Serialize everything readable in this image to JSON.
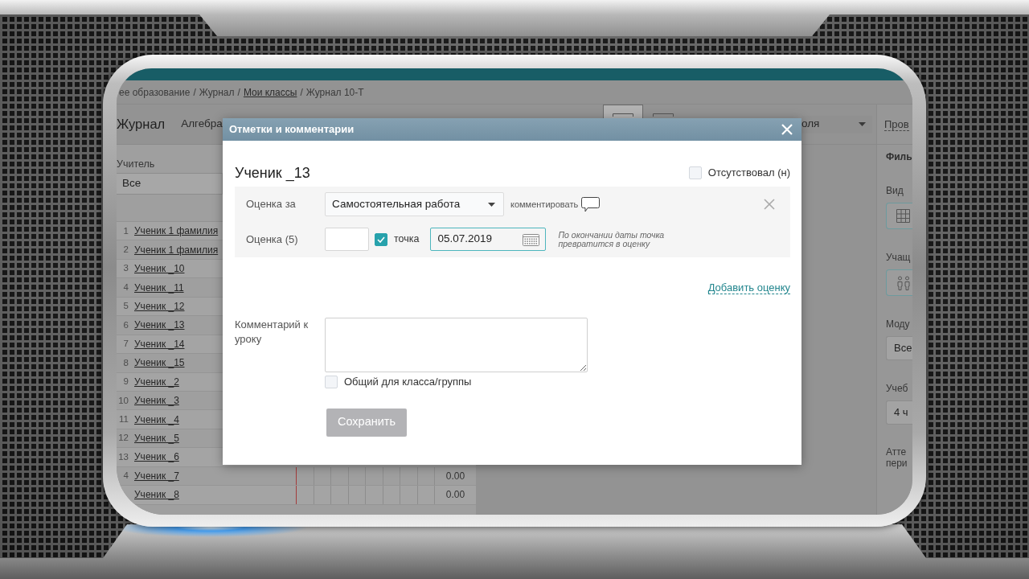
{
  "breadcrumb": [
    {
      "kind": "text",
      "text": "ее образование"
    },
    {
      "kind": "separator",
      "text": "/"
    },
    {
      "kind": "text",
      "text": "Журнал"
    },
    {
      "kind": "separator",
      "text": "/"
    },
    {
      "kind": "link",
      "text": "Мои классы"
    },
    {
      "kind": "separator",
      "text": "/"
    },
    {
      "kind": "text",
      "text": "Журнал 10-Т"
    }
  ],
  "journal": {
    "title": "Журнал",
    "subject": "Алгебра",
    "view_buttons": [
      {
        "selected": true
      },
      {
        "selected": false
      }
    ],
    "period_select": "оля"
  },
  "sidebar": {
    "link": "Пров",
    "title": "Филь",
    "sections": [
      {
        "kind": "grid-toggle",
        "label": "Вид"
      },
      {
        "kind": "people-toggle",
        "label": "Учащ"
      },
      {
        "kind": "select",
        "label": "Моду",
        "value": "Все"
      },
      {
        "kind": "select",
        "label": "Учеб",
        "value": "4 ч"
      },
      {
        "kind": "label",
        "label": "Атте пери"
      }
    ]
  },
  "teacher_filter": {
    "label": "Учитель",
    "value": "Все"
  },
  "students": [
    {
      "number": "1",
      "name": "Ученик 1 фамилия"
    },
    {
      "number": "2",
      "name": "Ученик 1 фамилия"
    },
    {
      "number": "3",
      "name": "Ученик _10"
    },
    {
      "number": "4",
      "name": "Ученик _11"
    },
    {
      "number": "5",
      "name": "Ученик _12"
    },
    {
      "number": "6",
      "name": "Ученик _13"
    },
    {
      "number": "7",
      "name": "Ученик _14"
    },
    {
      "number": "8",
      "name": "Ученик _15"
    },
    {
      "number": "9",
      "name": "Ученик _2"
    },
    {
      "number": "10",
      "name": "Ученик _3"
    },
    {
      "number": "11",
      "name": "Ученик _4"
    },
    {
      "number": "12",
      "name": "Ученик _5"
    },
    {
      "number": "13",
      "name": "Ученик _6"
    },
    {
      "number": "4",
      "name": "Ученик _7",
      "average": "0.00"
    },
    {
      "name": "Ученик _8",
      "average": "0.00"
    }
  ],
  "dialog": {
    "title": "Отметки и комментарии",
    "student": "Ученик _13",
    "absent": {
      "label": "Отсутствовал (н)",
      "checked": false
    },
    "grade": {
      "for_label": "Оценка за",
      "work_type": "Самостоятельная работа",
      "comment_link": "комментировать",
      "value_label": "Оценка (5)",
      "point": {
        "label": "точка",
        "checked": true
      },
      "date": "05.07.2019",
      "hint": "По окончании даты точка превратится в оценку"
    },
    "add_grade": "Добавить оценку",
    "comment": {
      "label": "Комментарий к уроку",
      "shared": {
        "label": "Общий для класса/группы",
        "checked": false
      }
    },
    "save": {
      "label": "Сохранить",
      "disabled": true
    }
  }
}
